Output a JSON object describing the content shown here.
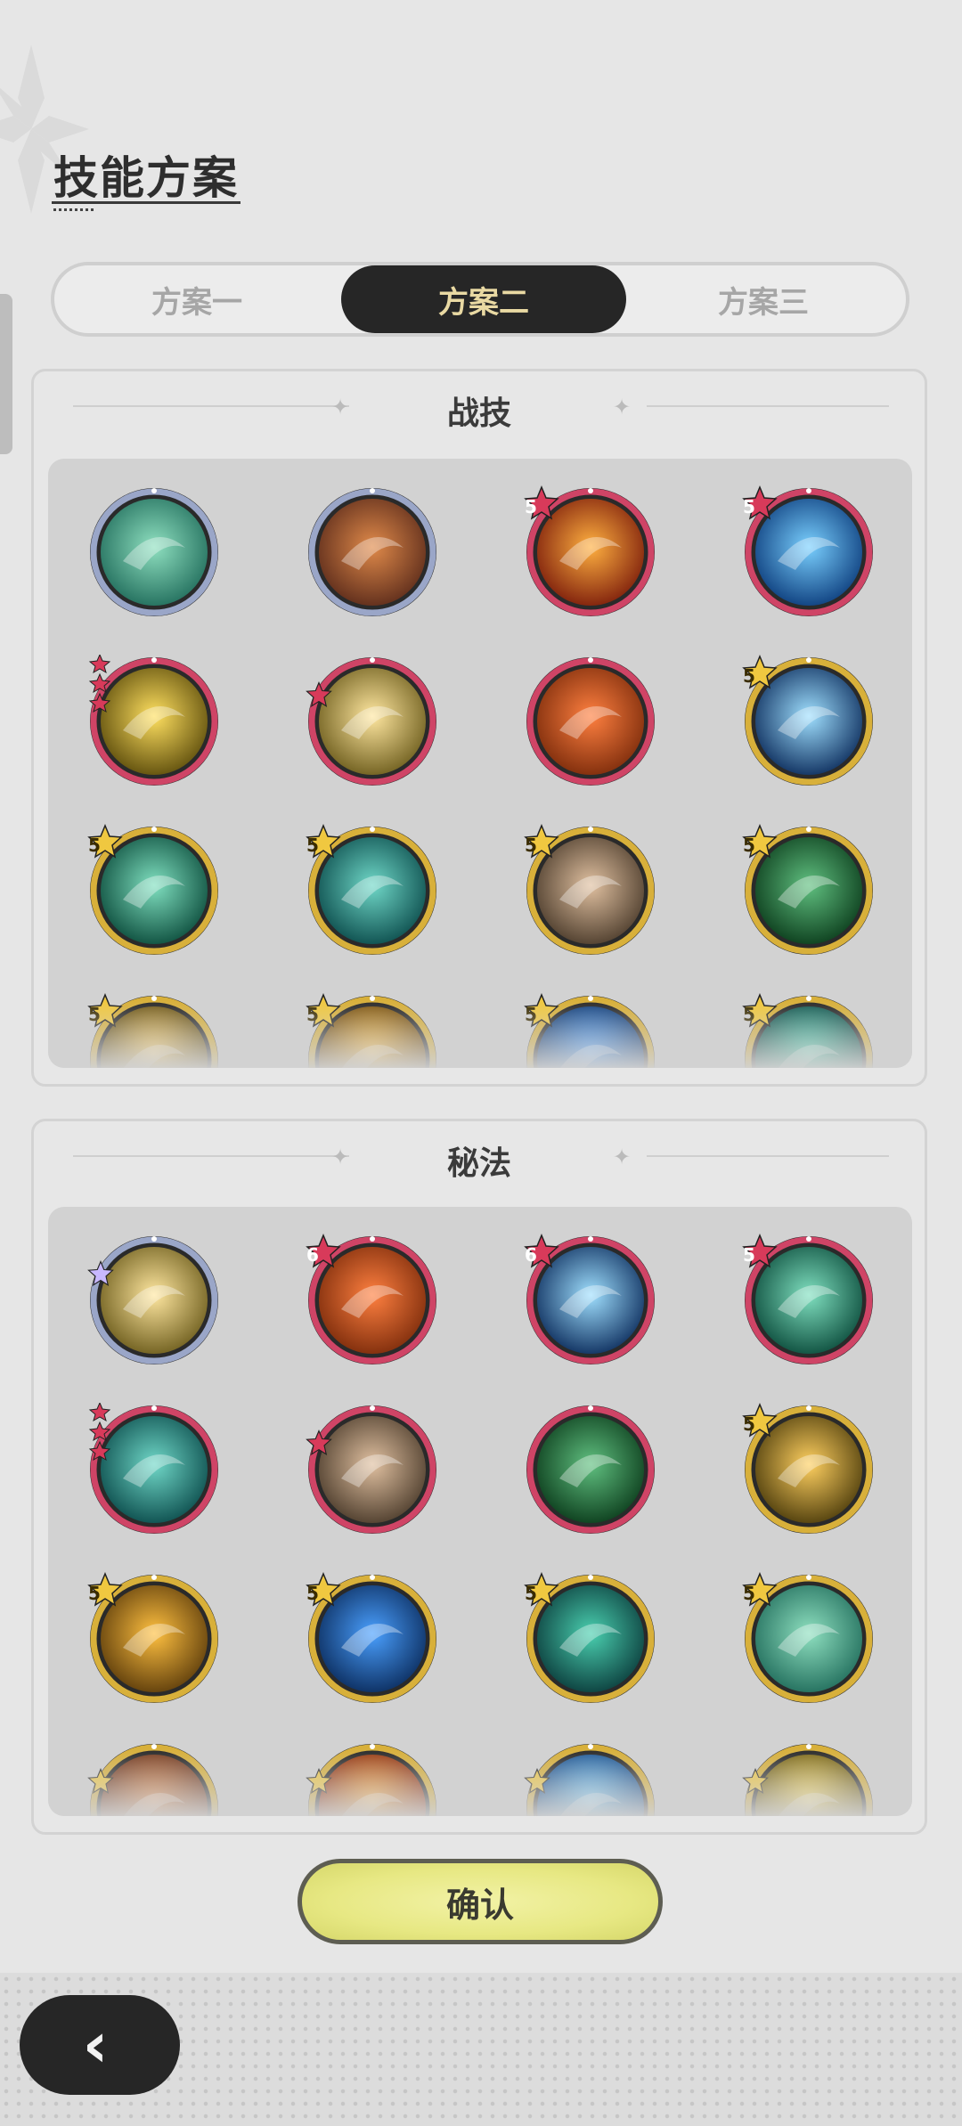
{
  "header": {
    "title": "技能方案"
  },
  "tabs": [
    {
      "label": "方案一",
      "active": false
    },
    {
      "label": "方案二",
      "active": true
    },
    {
      "label": "方案三",
      "active": false
    }
  ],
  "sections": [
    {
      "title": "战技",
      "skills": [
        {
          "icon": "green-wind-orb-icon",
          "frame": "rainbow",
          "badge": ""
        },
        {
          "icon": "meteor-icon",
          "frame": "rainbow",
          "badge": ""
        },
        {
          "icon": "fire-burst-icon",
          "frame": "red",
          "badge": "5"
        },
        {
          "icon": "water-vortex-icon",
          "frame": "red",
          "badge": "5"
        },
        {
          "icon": "lightning-strike-icon",
          "frame": "red",
          "badge": "stars3"
        },
        {
          "icon": "light-slash-icon",
          "frame": "red",
          "badge": "star"
        },
        {
          "icon": "flame-wave-icon",
          "frame": "red",
          "badge": ""
        },
        {
          "icon": "ice-shatter-icon",
          "frame": "gold",
          "badge": "5"
        },
        {
          "icon": "wind-blade-icon",
          "frame": "gold",
          "badge": "5"
        },
        {
          "icon": "cyclone-icon",
          "frame": "gold",
          "badge": "5"
        },
        {
          "icon": "rock-cards-icon",
          "frame": "gold",
          "badge": "5"
        },
        {
          "icon": "healing-cross-icon",
          "frame": "gold",
          "badge": "5"
        },
        {
          "icon": "golden-arc-icon",
          "frame": "gold",
          "badge": "5"
        },
        {
          "icon": "sun-flare-icon",
          "frame": "gold",
          "badge": "5"
        },
        {
          "icon": "blue-wave-icon",
          "frame": "gold",
          "badge": "5"
        },
        {
          "icon": "teal-wave-icon",
          "frame": "gold",
          "badge": "5"
        }
      ]
    },
    {
      "title": "秘法",
      "skills": [
        {
          "icon": "arcane-clock-icon",
          "frame": "rainbow",
          "badge": "star-purple"
        },
        {
          "icon": "star-spark-icon",
          "frame": "red",
          "badge": "6"
        },
        {
          "icon": "golden-aura-figure-icon",
          "frame": "red",
          "badge": "6"
        },
        {
          "icon": "green-spike-icon",
          "frame": "red",
          "badge": "5"
        },
        {
          "icon": "water-drop-icon",
          "frame": "red",
          "badge": "stars3"
        },
        {
          "icon": "rising-arrows-icon",
          "frame": "red",
          "badge": "star"
        },
        {
          "icon": "flame-figure-icon",
          "frame": "red",
          "badge": ""
        },
        {
          "icon": "heart-shield-icon",
          "frame": "gold",
          "badge": "5"
        },
        {
          "icon": "crystal-armor-icon",
          "frame": "gold",
          "badge": "5"
        },
        {
          "icon": "leaf-armor-icon",
          "frame": "gold",
          "badge": "5"
        },
        {
          "icon": "blue-figure-icon",
          "frame": "gold",
          "badge": "5"
        },
        {
          "icon": "green-figure-icon",
          "frame": "gold",
          "badge": "5"
        },
        {
          "icon": "green-shield-icon",
          "frame": "gold",
          "badge": "star-gold"
        },
        {
          "icon": "ice-crown-icon",
          "frame": "gold",
          "badge": "star-gold"
        },
        {
          "icon": "red-figure-icon",
          "frame": "gold",
          "badge": "star-gold"
        },
        {
          "icon": "red-flame-icon",
          "frame": "gold",
          "badge": "star-gold"
        }
      ]
    }
  ],
  "confirm_label": "确认",
  "back_icon": "chevron-left-icon",
  "colors": {
    "tab_active_bg": "#262626",
    "tab_active_text": "#e9d9a3",
    "confirm_bg": "#e7e883",
    "frame_red": "#d24a6a",
    "frame_gold": "#d9b23a"
  }
}
